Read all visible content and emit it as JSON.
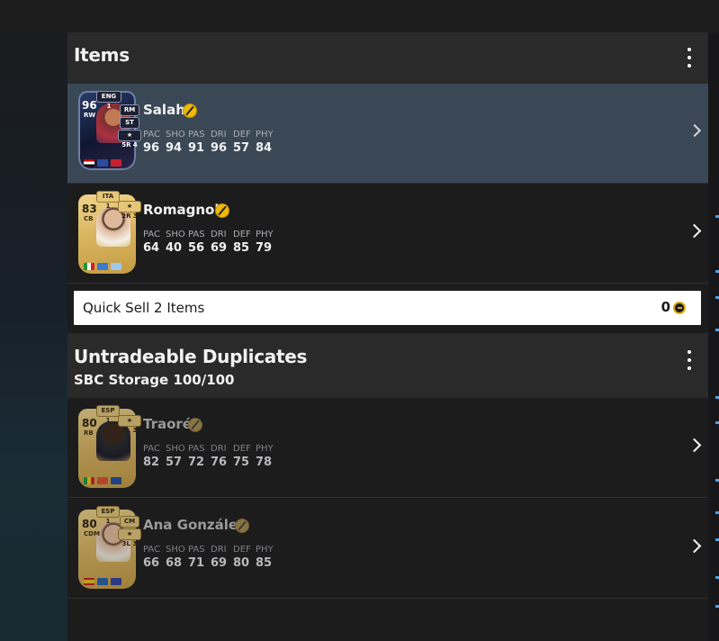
{
  "items_section": {
    "title": "Items",
    "players": [
      {
        "name": "Salah",
        "card": "totw",
        "rating": "96",
        "position": "RW",
        "league_tag": "ENG 1",
        "alt_positions": [
          "RM",
          "ST"
        ],
        "playstyle_tag": "★ 5R 4",
        "stat_labels": [
          "PAC",
          "SHO",
          "PAS",
          "DRI",
          "DEF",
          "PHY"
        ],
        "stats": [
          "96",
          "94",
          "91",
          "96",
          "57",
          "84"
        ],
        "selected": true
      },
      {
        "name": "Romagnoli",
        "card": "gold",
        "rating": "83",
        "position": "CB",
        "league_tag": "ITA 1",
        "playstyle_tag": "★ 2R 3",
        "stat_labels": [
          "PAC",
          "SHO",
          "PAS",
          "DRI",
          "DEF",
          "PHY"
        ],
        "stats": [
          "64",
          "40",
          "56",
          "69",
          "85",
          "79"
        ],
        "selected": false
      }
    ]
  },
  "quick_sell": {
    "label": "Quick Sell 2 Items",
    "value": "0",
    "icon": "coin-icon"
  },
  "duplicates_section": {
    "title": "Untradeable Duplicates",
    "subtitle": "SBC Storage 100/100",
    "players": [
      {
        "name": "Traoré",
        "card": "gold",
        "rating": "80",
        "position": "RB",
        "league_tag": "ESP 1",
        "playstyle_tag": "★ 3L 3",
        "stat_labels": [
          "PAC",
          "SHO",
          "PAS",
          "DRI",
          "DEF",
          "PHY"
        ],
        "stats": [
          "82",
          "57",
          "72",
          "76",
          "75",
          "78"
        ]
      },
      {
        "name": "Ana González",
        "card": "gold",
        "rating": "80",
        "position": "CDM",
        "league_tag": "ESP 1",
        "alt_positions": [
          "CM"
        ],
        "playstyle_tag": "★ 3L 3",
        "stat_labels": [
          "PAC",
          "SHO",
          "PAS",
          "DRI",
          "DEF",
          "PHY"
        ],
        "stats": [
          "66",
          "68",
          "71",
          "69",
          "80",
          "85"
        ]
      }
    ]
  },
  "icons": {
    "kebab": "more-vertical-icon",
    "chevron": "chevron-right-icon",
    "untradeable": "untradeable-icon"
  },
  "colors": {
    "selected_row": "#3a4856",
    "untradeable_badge": "#f0b90b",
    "accent_blue": "#4aa3e8"
  }
}
